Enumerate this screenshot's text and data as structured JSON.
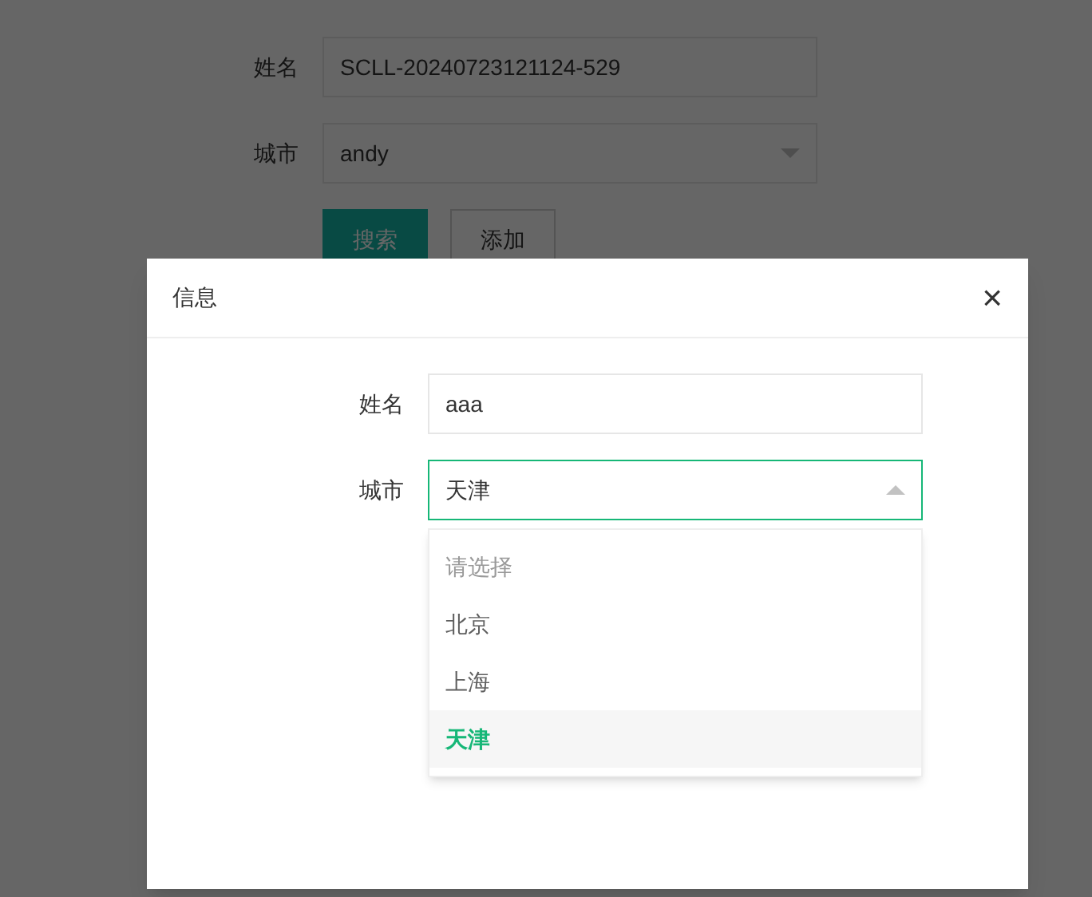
{
  "page": {
    "fields": [
      {
        "label": "姓名",
        "kind": "input",
        "value": "SCLL-20240723121124-529"
      },
      {
        "label": "城市",
        "kind": "select",
        "value": "andy"
      }
    ],
    "buttons": [
      {
        "label": "搜索",
        "kind": "primary"
      },
      {
        "label": "添加",
        "kind": "plain"
      }
    ]
  },
  "dialog": {
    "title": "信息",
    "close": "×",
    "fields": [
      {
        "label": "姓名",
        "kind": "input",
        "value": "aaa"
      },
      {
        "label": "城市",
        "kind": "select",
        "value": "天津",
        "expanded": true,
        "options": [
          {
            "label": "请选择",
            "kind": "placeholder",
            "selected": false
          },
          {
            "label": "北京",
            "kind": "option",
            "selected": false
          },
          {
            "label": "上海",
            "kind": "option",
            "selected": false
          },
          {
            "label": "天津",
            "kind": "option",
            "selected": true
          }
        ]
      }
    ]
  }
}
